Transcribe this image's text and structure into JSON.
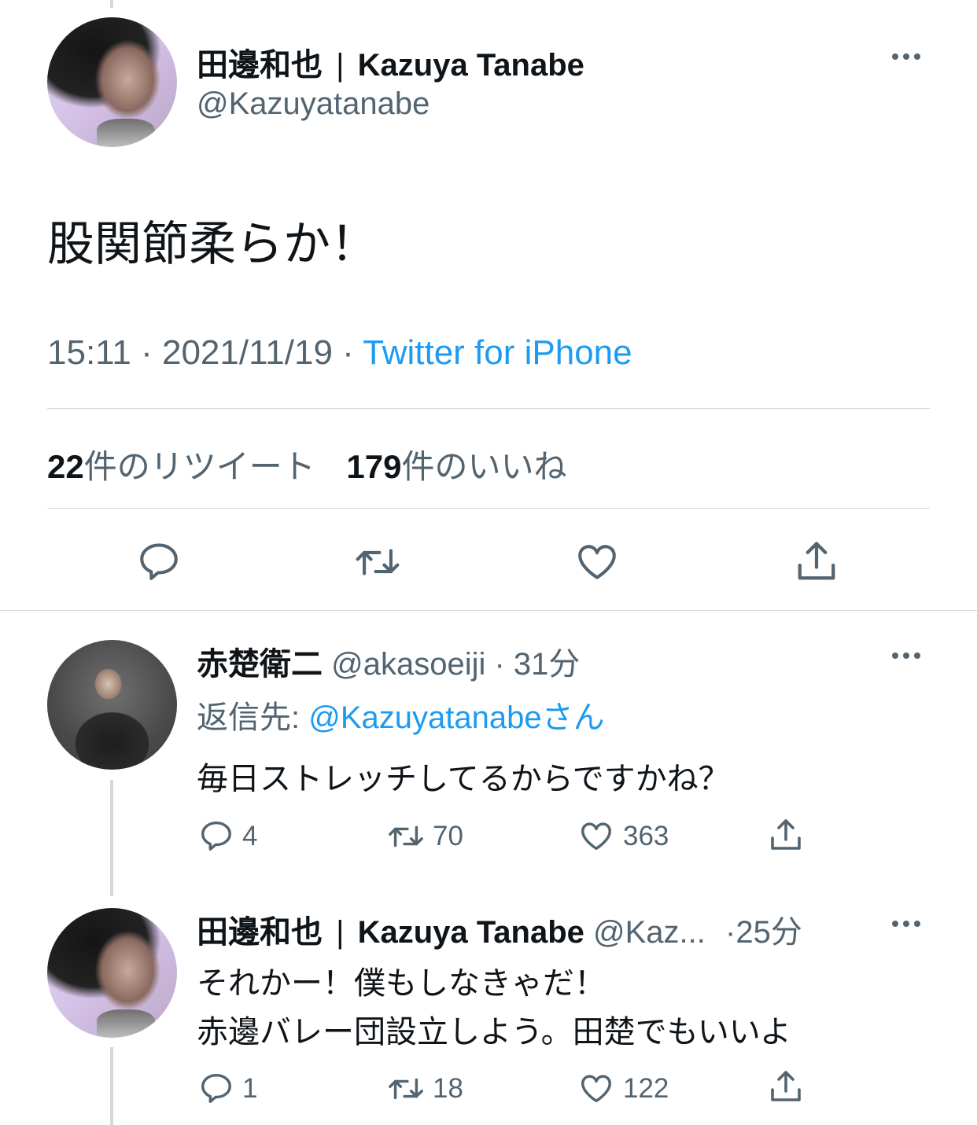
{
  "main_tweet": {
    "display_name": "田邊和也",
    "display_name_en": "Kazuya Tanabe",
    "separator": "|",
    "handle": "@Kazuyatanabe",
    "text": "股関節柔らか！",
    "time": "15:11",
    "date": "2021/11/19",
    "source": "Twitter for iPhone",
    "retweet_count": "22",
    "retweet_label": "件のリツイート",
    "like_count": "179",
    "like_label": "件のいいね"
  },
  "reply1": {
    "display_name": "赤楚衛二",
    "handle": "@akasoeiji",
    "time_ago": "31分",
    "reply_to_label": "返信先:",
    "reply_to_handle": "@Kazuyatanabeさん",
    "text": "毎日ストレッチしてるからですかね？",
    "replies": "4",
    "retweets": "70",
    "likes": "363"
  },
  "reply2": {
    "display_name": "田邊和也",
    "display_name_en": "Kazuya Tanabe",
    "separator": "|",
    "handle_truncated": "@Kaz...",
    "time_ago": "25分",
    "text_line1": "それかー！僕もしなきゃだ！",
    "text_line2": "赤邊バレー団設立しよう。田楚でもいいよ",
    "replies": "1",
    "retweets": "18",
    "likes": "122"
  },
  "colors": {
    "text": "#0f1419",
    "muted": "#536471",
    "link": "#1d9bf0",
    "divider": "#cfd9de"
  },
  "icons": [
    "more-icon",
    "reply-icon",
    "retweet-icon",
    "like-icon",
    "share-icon"
  ]
}
